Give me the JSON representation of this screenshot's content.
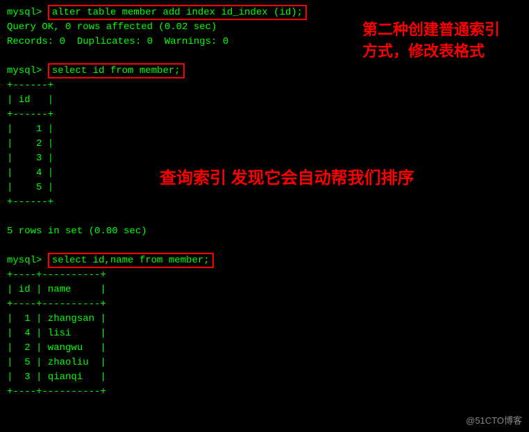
{
  "terminal": {
    "lines": [
      {
        "type": "prompt-cmd",
        "prompt": "mysql> ",
        "cmd": "alter table member add index id_index (id);"
      },
      {
        "type": "plain",
        "text": "Query OK, 0 rows affected (0.02 sec)"
      },
      {
        "type": "plain",
        "text": "Records: 0  Duplicates: 0  Warnings: 0"
      },
      {
        "type": "blank"
      },
      {
        "type": "prompt-cmd",
        "prompt": "mysql> ",
        "cmd": "select id from member;"
      },
      {
        "type": "plain",
        "text": "+------+"
      },
      {
        "type": "plain",
        "text": "| id   |"
      },
      {
        "type": "plain",
        "text": "+------+"
      },
      {
        "type": "plain",
        "text": "|    1 |"
      },
      {
        "type": "plain",
        "text": "|    2 |"
      },
      {
        "type": "plain",
        "text": "|    3 |"
      },
      {
        "type": "plain",
        "text": "|    4 |"
      },
      {
        "type": "plain",
        "text": "|    5 |"
      },
      {
        "type": "plain",
        "text": "+------+"
      },
      {
        "type": "blank"
      },
      {
        "type": "plain",
        "text": "5 rows in set (0.00 sec)"
      },
      {
        "type": "blank"
      },
      {
        "type": "prompt-cmd",
        "prompt": "mysql> ",
        "cmd": "select id,name from member;"
      },
      {
        "type": "plain",
        "text": "+---------+----------+"
      },
      {
        "type": "plain",
        "text": "| id      | name     |"
      },
      {
        "type": "plain",
        "text": "+---------+----------+"
      },
      {
        "type": "plain",
        "text": "|       1 | zhangsan |"
      },
      {
        "type": "plain",
        "text": "|       4 | lisi     |"
      },
      {
        "type": "plain",
        "text": "|       2 | wangwu   |"
      },
      {
        "type": "plain",
        "text": "|       5 | zhaoliu  |"
      },
      {
        "type": "plain",
        "text": "|       3 | qianqi   |"
      },
      {
        "type": "plain",
        "text": "+---------+----------+"
      }
    ]
  },
  "annotations": {
    "annotation1": "第二种创建普通索引\n方式，修改表格式",
    "annotation2": "查询索引 发现它会自动帮我们排序"
  },
  "watermark": "@51CTO博客"
}
